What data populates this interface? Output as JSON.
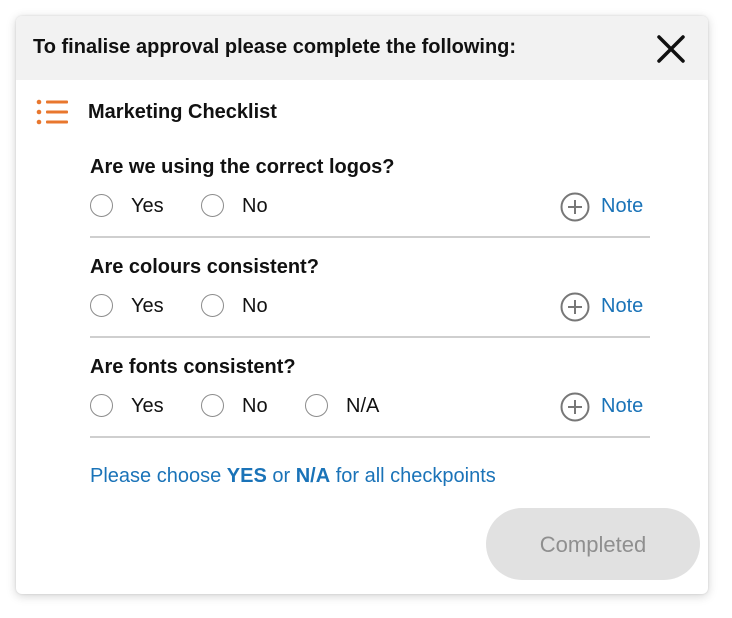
{
  "dialog": {
    "title": "To finalise approval please complete the following:",
    "close_icon": "close-icon"
  },
  "section": {
    "icon": "list-icon",
    "title": "Marketing Checklist"
  },
  "questions": [
    {
      "text": "Are we using the correct logos?",
      "options": [
        "Yes",
        "No"
      ],
      "note_label": "Note"
    },
    {
      "text": "Are colours consistent?",
      "options": [
        "Yes",
        "No"
      ],
      "note_label": "Note"
    },
    {
      "text": "Are fonts consistent?",
      "options": [
        "Yes",
        "No",
        "N/A"
      ],
      "note_label": "Note"
    }
  ],
  "hint": {
    "prefix": "Please choose ",
    "yes": "YES",
    "middle": " or ",
    "na": "N/A",
    "suffix": " for all checkpoints"
  },
  "completed_button": {
    "label": "Completed",
    "enabled": false
  },
  "colors": {
    "accent_orange": "#e8772e",
    "link_blue": "#1a73b8",
    "header_bg": "#f2f2f2",
    "button_disabled_bg": "#e1e1e1"
  }
}
